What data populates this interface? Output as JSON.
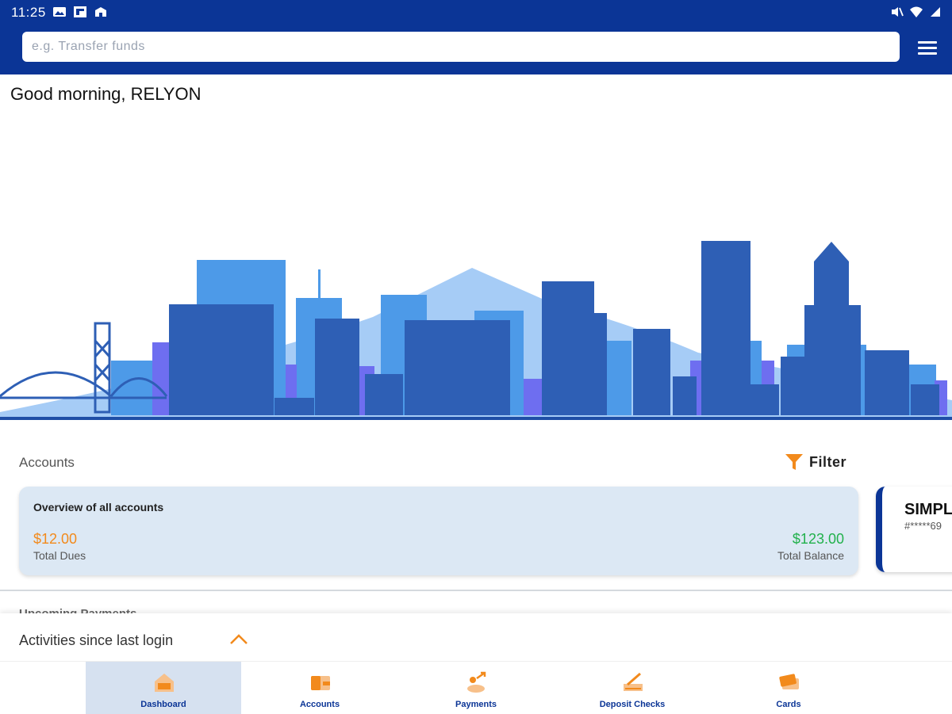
{
  "status_bar": {
    "time": "11:25"
  },
  "search": {
    "placeholder": "e.g. Transfer funds"
  },
  "greeting": "Good morning, RELYON",
  "accounts": {
    "title": "Accounts",
    "filter_label": "Filter",
    "overview": {
      "title": "Overview of all accounts",
      "dues_value": "$12.00",
      "dues_label": "Total Dues",
      "balance_value": "$123.00",
      "balance_label": "Total Balance"
    },
    "card": {
      "name": "SIMPL",
      "number": "#*****69"
    }
  },
  "upcoming_payments_title": "Upcoming Payments",
  "activities": {
    "label": "Activities since last login"
  },
  "bottom_nav": {
    "items": [
      {
        "label": "Dashboard",
        "icon": "dashboard-icon",
        "active": true
      },
      {
        "label": "Accounts",
        "icon": "wallet-icon",
        "active": false
      },
      {
        "label": "Payments",
        "icon": "payments-icon",
        "active": false
      },
      {
        "label": "Deposit Checks",
        "icon": "deposit-check-icon",
        "active": false
      },
      {
        "label": "Cards",
        "icon": "cards-icon",
        "active": false
      }
    ]
  },
  "colors": {
    "brand_blue": "#0b3596",
    "dues_orange": "#f28a1c",
    "balance_green": "#22b14c",
    "card_bg": "#dce8f4"
  }
}
